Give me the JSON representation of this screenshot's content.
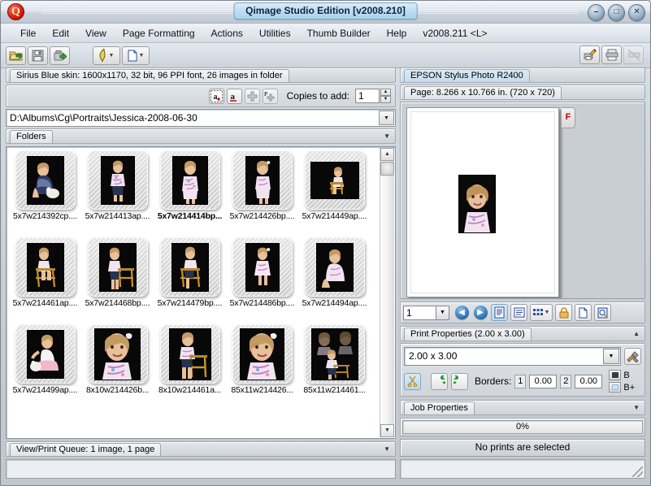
{
  "window": {
    "title": "Qimage Studio Edition [v2008.210]",
    "logo_letter": "Q",
    "minimize": "–",
    "maximize": "□",
    "close": "✕"
  },
  "menu": {
    "items": [
      "File",
      "Edit",
      "View",
      "Page Formatting",
      "Actions",
      "Utilities",
      "Thumb Builder",
      "Help"
    ],
    "version": "v2008.211 <L>"
  },
  "toolbar": {
    "left_icons": [
      "open-folder-icon",
      "save-icon",
      "export-icon",
      "filter-icon",
      "new-page-icon"
    ],
    "right_icons": [
      "edit-print-icon",
      "print-icon",
      "print-disabled-icon"
    ]
  },
  "skin_bar": {
    "label": "Sirius Blue skin: 1600x1170, 32 bit, 96 PPI font, 26 images in folder"
  },
  "copies": {
    "buttons": [
      "add-all-icon",
      "add-selected-icon",
      "plus-icon",
      "plus-page-icon"
    ],
    "label": "Copies to add:",
    "value": "1",
    "spin_up": "▲",
    "spin_down": "▼"
  },
  "path": {
    "value": "D:\\Albums\\Cg\\Portraits\\Jessica-2008-06-30",
    "dropdown": "▼"
  },
  "folders_tab": {
    "label": "Folders",
    "caret": "▼"
  },
  "thumbnails": {
    "rows": [
      [
        {
          "name": "5x7w214392cp....",
          "selected": false,
          "pose": "sitting-bunny-navy"
        },
        {
          "name": "5x7w214413ap....",
          "selected": false,
          "pose": "standing-floral"
        },
        {
          "name": "5x7w214414bp...",
          "selected": true,
          "pose": "standing-floral-b"
        },
        {
          "name": "5x7w214426bp....",
          "selected": false,
          "pose": "standing-bow"
        },
        {
          "name": "5x7w214449ap....",
          "selected": false,
          "pose": "chair-wide"
        }
      ],
      [
        {
          "name": "5x7w214461ap....",
          "selected": false,
          "pose": "chair-sit"
        },
        {
          "name": "5x7w214468bp....",
          "selected": false,
          "pose": "chair-stand"
        },
        {
          "name": "5x7w214479bp....",
          "selected": false,
          "pose": "chair-lean"
        },
        {
          "name": "5x7w214486bp....",
          "selected": false,
          "pose": "standing-dress"
        },
        {
          "name": "5x7w214494ap....",
          "selected": false,
          "pose": "sitting-floor"
        }
      ],
      [
        {
          "name": "5x7w214499ap....",
          "selected": false,
          "pose": "sitting-bunny-pink"
        },
        {
          "name": "8x10w214426b...",
          "selected": false,
          "pose": "closeup-bow"
        },
        {
          "name": "8x10w214461a...",
          "selected": false,
          "pose": "chair-stand-2"
        },
        {
          "name": "85x11w214426...",
          "selected": false,
          "pose": "closeup-bow-2"
        },
        {
          "name": "85x11w214461...",
          "selected": false,
          "pose": "collage"
        }
      ]
    ],
    "scroll_up": "▲",
    "scroll_down": "▼"
  },
  "queue": {
    "label": "View/Print Queue: 1 image, 1 page",
    "caret": "▼"
  },
  "printer": {
    "tab": "EPSON Stylus Photo R2400",
    "page_info": "Page: 8.266 x 10.766 in.  (720 x 720)",
    "page_flag": "F"
  },
  "nav": {
    "page_value": "1",
    "page_dropdown": "▼",
    "prev": "◀",
    "next": "▶",
    "icons": [
      "prev-page-icon",
      "next-page-icon",
      "page-view-icon",
      "list-view-icon",
      "grid-view-icon",
      "lock-icon",
      "new-page-icon",
      "preview-zoom-icon"
    ],
    "grid_caret": "▼"
  },
  "print_properties": {
    "header": "Print Properties (2.00 x 3.00)",
    "collapse_caret": "▲",
    "size_value": "2.00 x 3.00",
    "size_dropdown": "▼",
    "tools_icon": "tools-icon",
    "crop_icon": "scissors-icon",
    "rotate_left_icon": "rotate-left-icon",
    "rotate_right_icon": "rotate-right-icon",
    "borders_label": "Borders:",
    "border1_index": "1",
    "border1_value": "0.00",
    "border2_index": "2",
    "border2_value": "0.00",
    "b_label": "B",
    "bplus_label": "B+"
  },
  "job_properties": {
    "label": "Job Properties",
    "caret": "▼"
  },
  "progress": {
    "percent_label": "0%",
    "value": 0
  },
  "status": {
    "message": "No prints are selected"
  },
  "colors": {
    "accent_blue": "#2a6cae",
    "title_pill": "#bcdef2",
    "logo_red": "#c81409",
    "selection_bold": "#000000",
    "green_rotate": "#1f9e2e",
    "lock_orange": "#e8a33d"
  }
}
